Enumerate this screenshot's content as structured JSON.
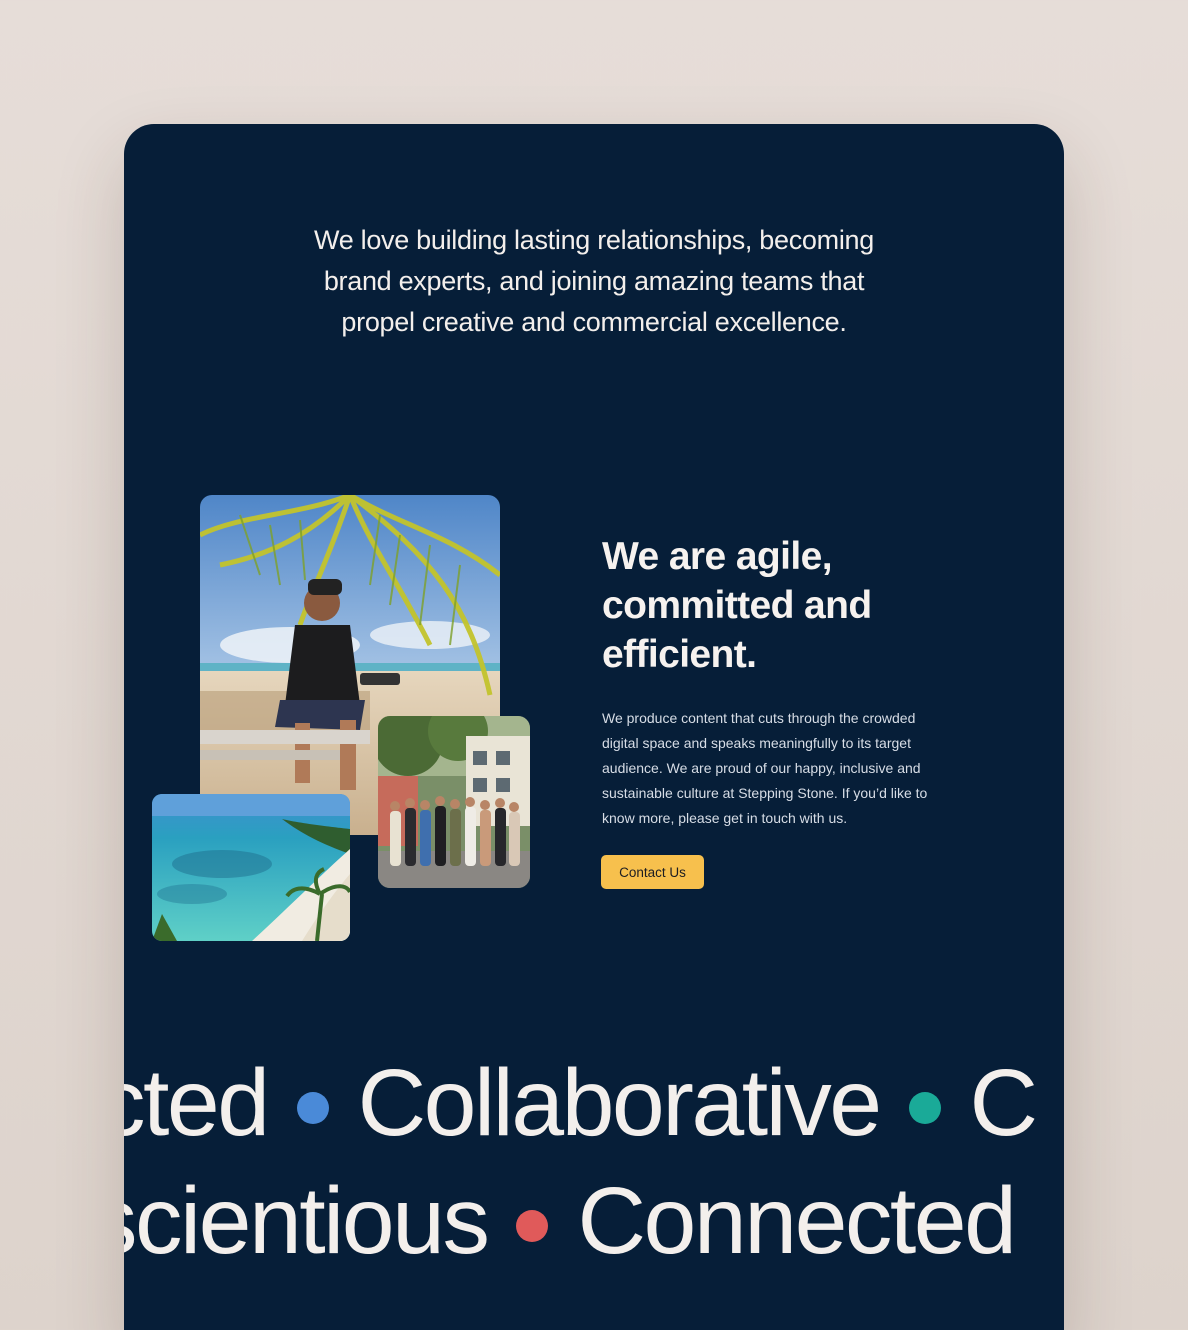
{
  "intro": {
    "text": "We love building lasting relationships, becoming brand experts, and joining amazing teams that propel creative and commercial excellence."
  },
  "feature": {
    "heading": "We are agile, committed and efficient.",
    "body": "We produce content that cuts through the crowded digital space and speaks meaningfully to its target audience. We are proud of our happy, inclusive and sustainable culture at Stepping Stone. If you’d like to know more, please get in touch with us.",
    "cta_label": "Contact Us",
    "cta_color": "#f7c04d"
  },
  "ticker_row_1": {
    "words": [
      "cted",
      "Collaborative",
      "C"
    ],
    "dot_colors": [
      "#4a8ad8",
      "#1aaa98"
    ]
  },
  "ticker_row_2": {
    "words": [
      "scientious",
      "Connected"
    ],
    "dot_colors": [
      "#e05a5a"
    ]
  },
  "colors": {
    "background": "#e4dbd6",
    "card": "#061e38",
    "text": "#f3efec"
  }
}
